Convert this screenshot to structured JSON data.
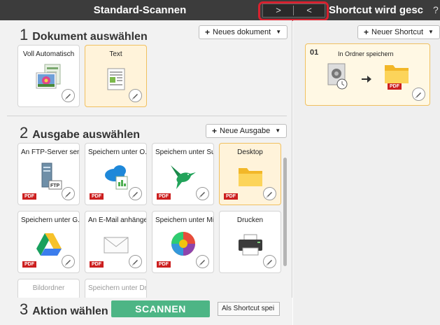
{
  "titlebar": {
    "left_title": "Standard-Scannen",
    "nav_next": ">",
    "nav_prev": "<",
    "right_title": "Shortcut wird gesc",
    "help": "?"
  },
  "section1": {
    "number": "1",
    "label": "Dokument auswählen",
    "new_button": "Neues dokument",
    "cards": [
      {
        "label": "Voll Automatisch",
        "icon": "photo-stack-icon",
        "selected": false
      },
      {
        "label": "Text",
        "icon": "text-document-icon",
        "selected": true
      }
    ]
  },
  "section2": {
    "number": "2",
    "label": "Ausgabe auswählen",
    "new_button": "Neue Ausgabe",
    "cards": [
      {
        "label": "An FTP-Server sen...",
        "badge": "PDF",
        "icon": "ftp-server-icon",
        "selected": false
      },
      {
        "label": "Speichern unter O...",
        "badge": "PDF",
        "icon": "onedrive-icon",
        "selected": false
      },
      {
        "label": "Speichern unter Su...",
        "badge": "PDF",
        "icon": "hummingbird-icon",
        "selected": false
      },
      {
        "label": "Desktop",
        "badge": "PDF",
        "icon": "folder-icon",
        "selected": true
      },
      {
        "label": "Speichern unter G...",
        "badge": "PDF",
        "icon": "google-drive-icon",
        "selected": false
      },
      {
        "label": "An E-Mail anhängen",
        "badge": "PDF",
        "icon": "email-icon",
        "selected": false
      },
      {
        "label": "Speichern unter Mi...",
        "badge": "PDF",
        "icon": "color-wheel-icon",
        "selected": false
      },
      {
        "label": "Drucken",
        "badge": "",
        "icon": "printer-icon",
        "selected": false
      },
      {
        "label": "Bildordner",
        "badge": "",
        "icon": "",
        "selected": false
      },
      {
        "label": "Speichern unter Dr...",
        "badge": "",
        "icon": "",
        "selected": false
      }
    ]
  },
  "section3": {
    "number": "3",
    "label": "Aktion wählen",
    "scan_button": "SCANNEN",
    "shortcut_button": "Als Shortcut spei"
  },
  "shortcut_panel": {
    "new_button": "Neuer Shortcut",
    "card": {
      "number": "01",
      "label": "In Ordner speichern",
      "badge": "PDF"
    }
  },
  "colors": {
    "titlebar": "#3c3c3c",
    "scan_button": "#4db585",
    "selected_card": "#fff3da",
    "highlight_border": "#d8212f",
    "pdf_badge": "#cc1f1f"
  }
}
